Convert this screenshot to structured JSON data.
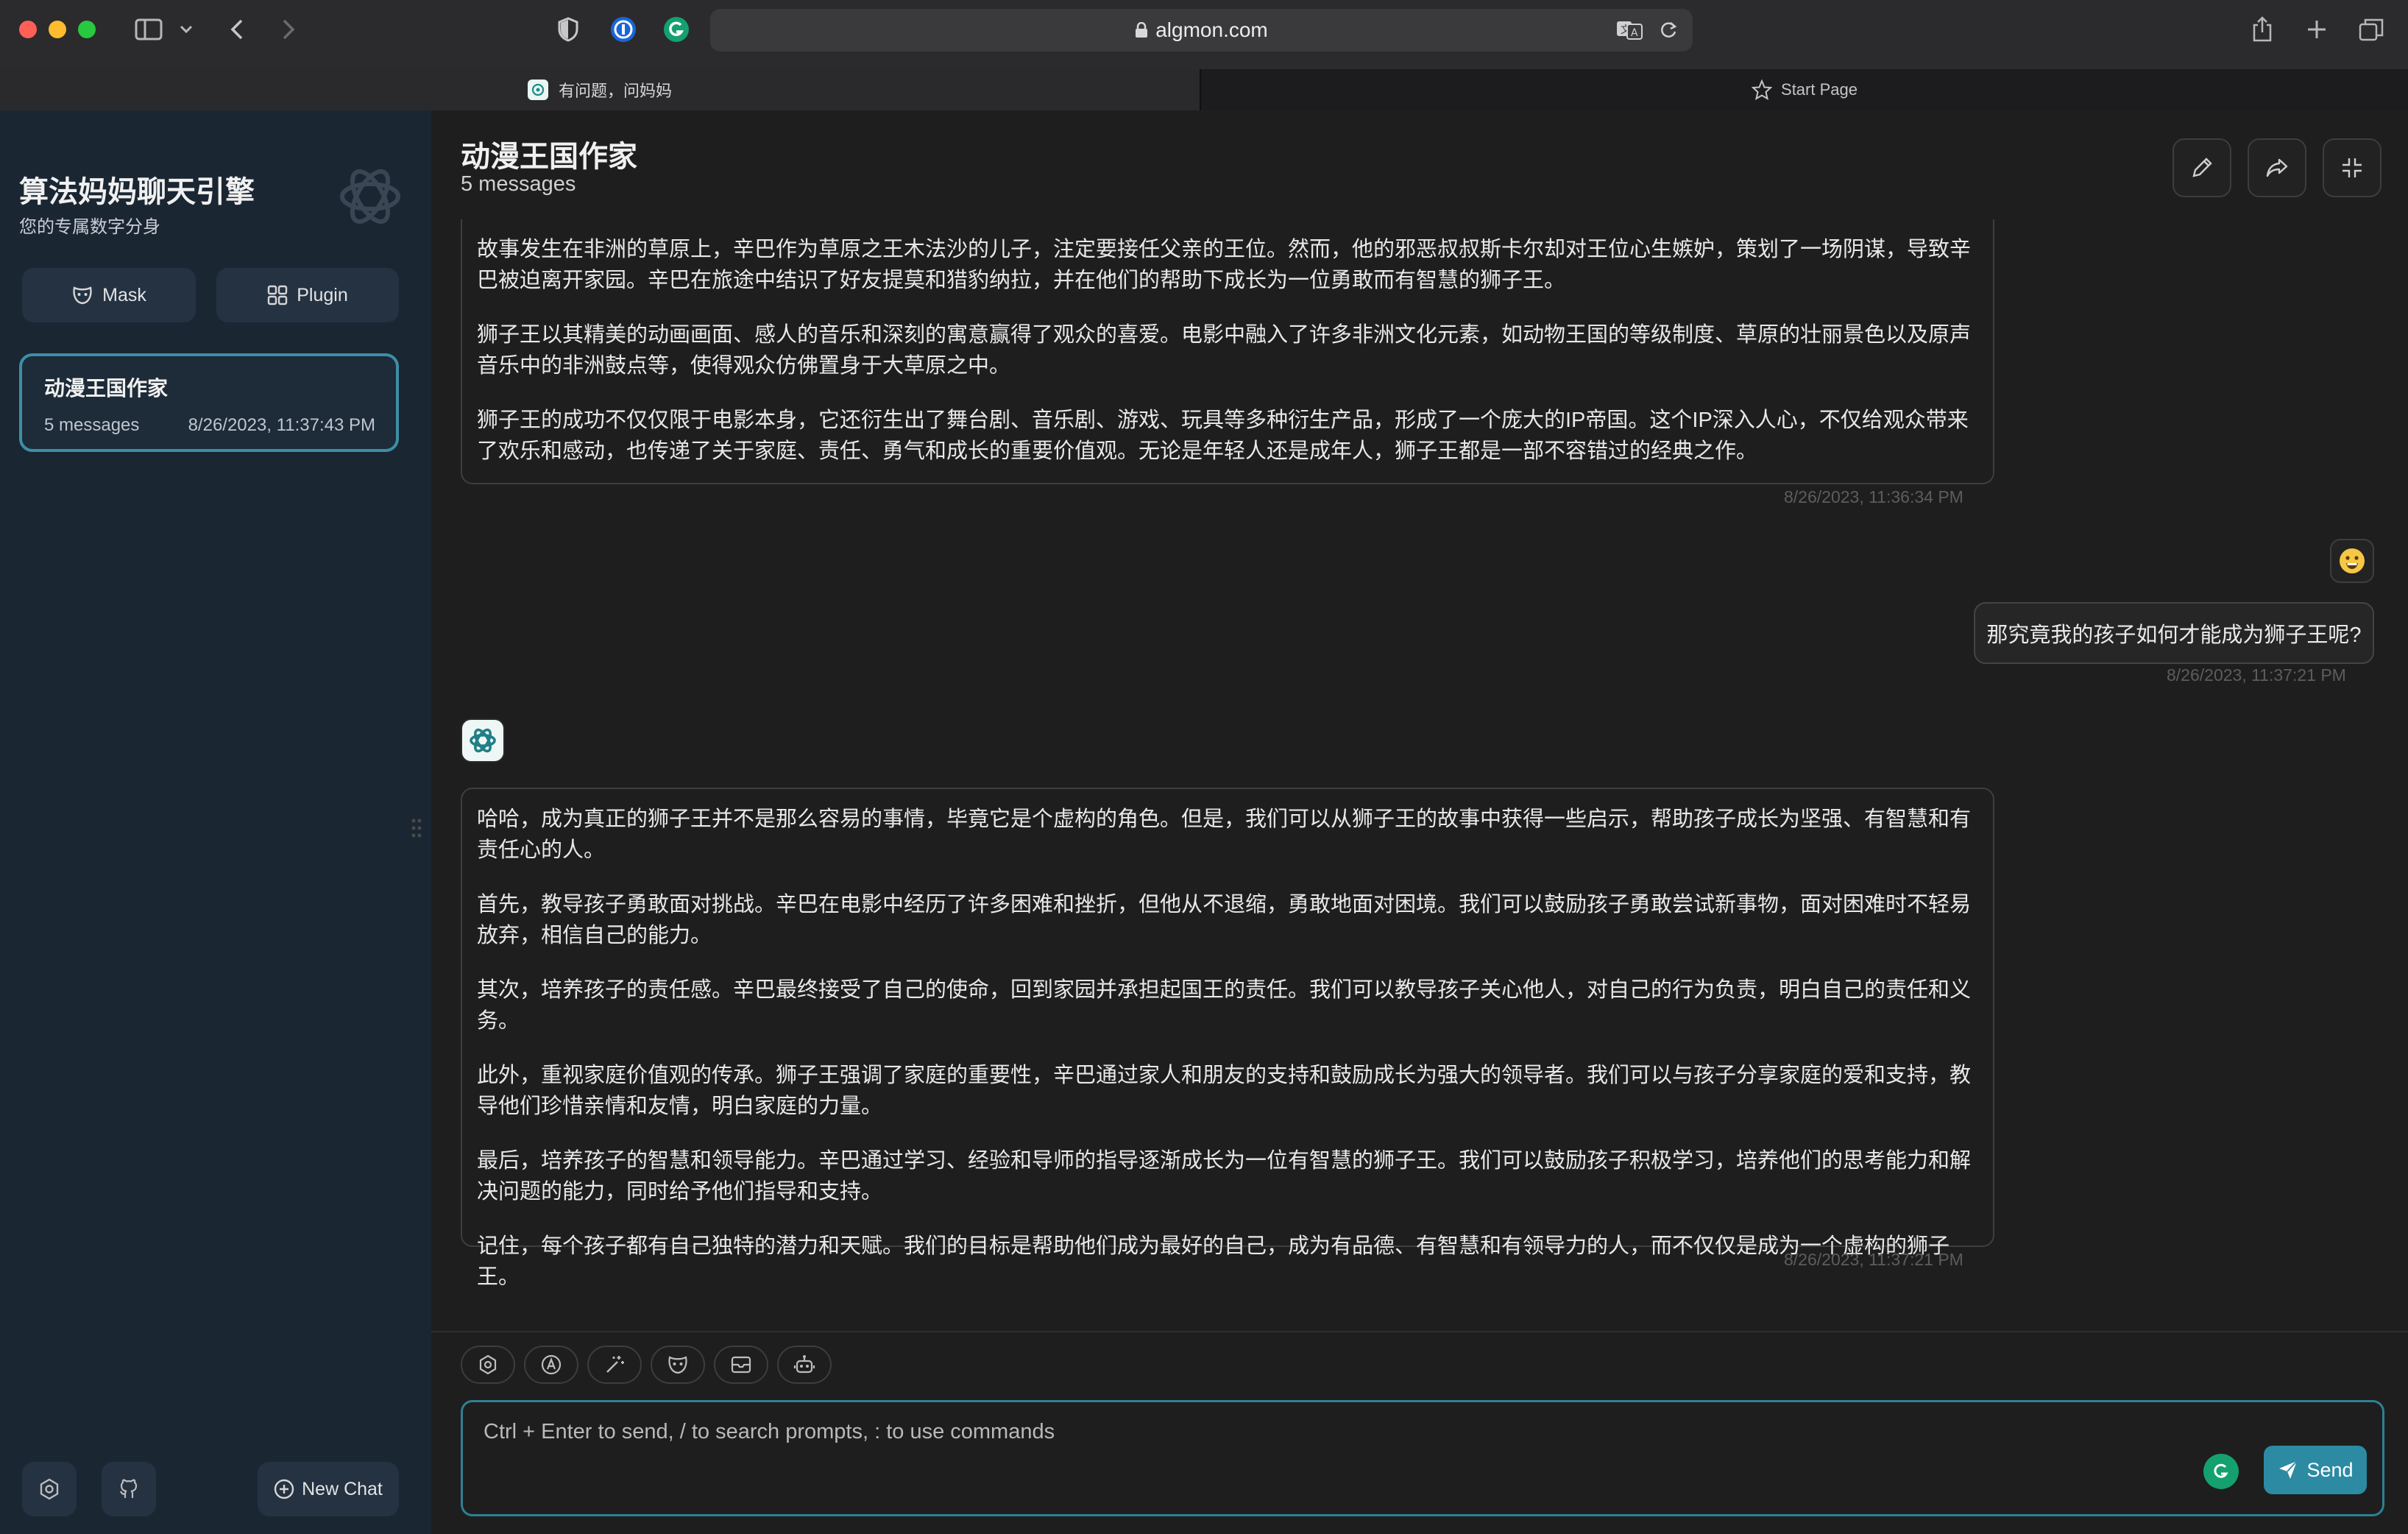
{
  "browser": {
    "url": "algmon.com",
    "tabs": [
      {
        "label": "有问题，问妈妈"
      },
      {
        "label": "Start Page"
      }
    ]
  },
  "sidebar": {
    "title": "算法妈妈聊天引擎",
    "subtitle": "您的专属数字分身",
    "mask_label": "Mask",
    "plugin_label": "Plugin",
    "chats": [
      {
        "title": "动漫王国作家",
        "count": "5 messages",
        "date": "8/26/2023, 11:37:43 PM"
      }
    ],
    "new_chat_label": "New Chat"
  },
  "chat": {
    "title": "动漫王国作家",
    "count": "5 messages",
    "messages": [
      {
        "role": "assistant",
        "paragraphs": [
          "故事发生在非洲的草原上，辛巴作为草原之王木法沙的儿子，注定要接任父亲的王位。然而，他的邪恶叔叔斯卡尔却对王位心生嫉妒，策划了一场阴谋，导致辛巴被迫离开家园。辛巴在旅途中结识了好友提莫和猎豹纳拉，并在他们的帮助下成长为一位勇敢而有智慧的狮子王。",
          "狮子王以其精美的动画画面、感人的音乐和深刻的寓意赢得了观众的喜爱。电影中融入了许多非洲文化元素，如动物王国的等级制度、草原的壮丽景色以及原声音乐中的非洲鼓点等，使得观众仿佛置身于大草原之中。",
          "狮子王的成功不仅仅限于电影本身，它还衍生出了舞台剧、音乐剧、游戏、玩具等多种衍生产品，形成了一个庞大的IP帝国。这个IP深入人心，不仅给观众带来了欢乐和感动，也传递了关于家庭、责任、勇气和成长的重要价值观。无论是年轻人还是成年人，狮子王都是一部不容错过的经典之作。"
        ],
        "time": "8/26/2023, 11:36:34 PM"
      },
      {
        "role": "user",
        "text": "那究竟我的孩子如何才能成为狮子王呢?",
        "time": "8/26/2023, 11:37:21 PM"
      },
      {
        "role": "assistant",
        "paragraphs": [
          "哈哈，成为真正的狮子王并不是那么容易的事情，毕竟它是个虚构的角色。但是，我们可以从狮子王的故事中获得一些启示，帮助孩子成长为坚强、有智慧和有责任心的人。",
          "首先，教导孩子勇敢面对挑战。辛巴在电影中经历了许多困难和挫折，但他从不退缩，勇敢地面对困境。我们可以鼓励孩子勇敢尝试新事物，面对困难时不轻易放弃，相信自己的能力。",
          "其次，培养孩子的责任感。辛巴最终接受了自己的使命，回到家园并承担起国王的责任。我们可以教导孩子关心他人，对自己的行为负责，明白自己的责任和义务。",
          "此外，重视家庭价值观的传承。狮子王强调了家庭的重要性，辛巴通过家人和朋友的支持和鼓励成长为强大的领导者。我们可以与孩子分享家庭的爱和支持，教导他们珍惜亲情和友情，明白家庭的力量。",
          "最后，培养孩子的智慧和领导能力。辛巴通过学习、经验和导师的指导逐渐成长为一位有智慧的狮子王。我们可以鼓励孩子积极学习，培养他们的思考能力和解决问题的能力，同时给予他们指导和支持。",
          "记住，每个孩子都有自己独特的潜力和天赋。我们的目标是帮助他们成为最好的自己，成为有品德、有智慧和有领导力的人，而不仅仅是成为一个虚构的狮子王。"
        ],
        "time": "8/26/2023, 11:37:21 PM"
      }
    ]
  },
  "composer": {
    "placeholder": "Ctrl + Enter to send, / to search prompts, : to use commands",
    "send_label": "Send"
  },
  "colors": {
    "accent": "#2c8aa3",
    "sidebar_bg": "#1b2633",
    "main_bg": "#1e1e1e"
  }
}
